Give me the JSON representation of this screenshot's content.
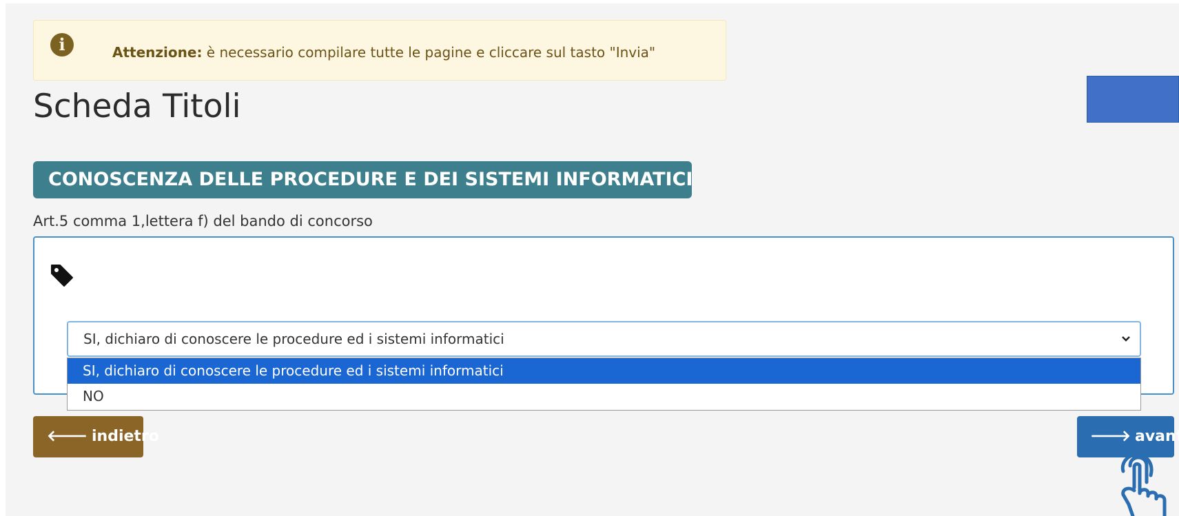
{
  "alert": {
    "icon": "info-circle-icon",
    "strong": "Attenzione:",
    "text": " è necessario compilare tutte le pagine e cliccare sul tasto \"Invia\""
  },
  "page_title": "Scheda Titoli",
  "section": {
    "title": "CONOSCENZA DELLE PROCEDURE E DEI SISTEMI INFORMATICI",
    "subtitle": "Art.5 comma 1,lettera f) del bando di concorso"
  },
  "select": {
    "value": "SI, dichiaro di conoscere le procedure ed i sistemi informatici",
    "options": [
      "SI, dichiaro di conoscere le procedure ed i sistemi informatici",
      "NO"
    ]
  },
  "buttons": {
    "back_label": "indietro",
    "next_label": "avanti"
  },
  "colors": {
    "accent_teal": "#3e7f8e",
    "back_button": "#8b6427",
    "next_button": "#2a6db0",
    "selected_option": "#1a66d3"
  }
}
